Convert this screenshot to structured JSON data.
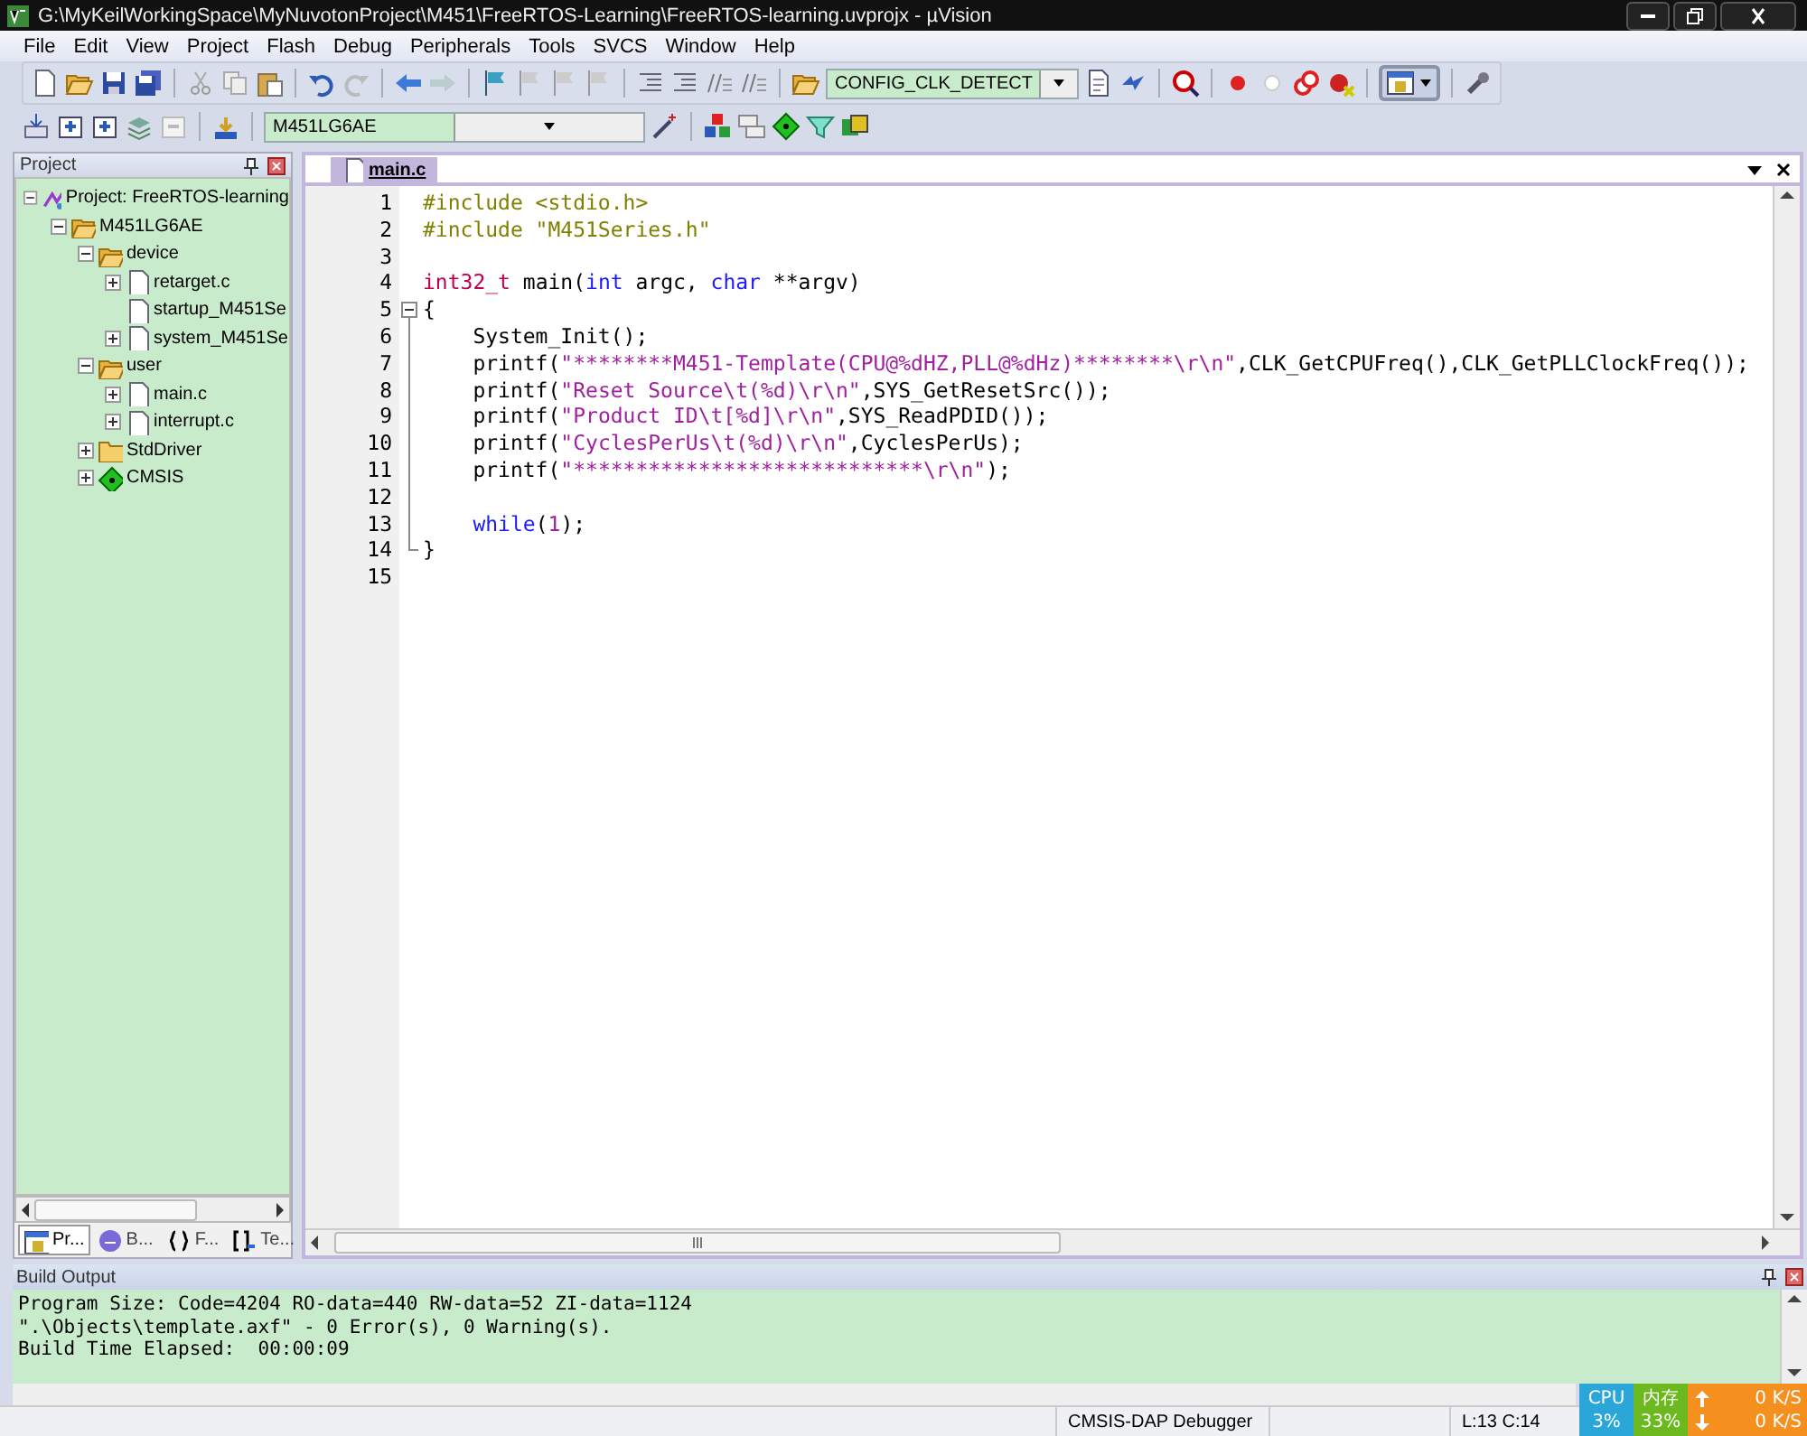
{
  "window": {
    "title": "G:\\MyKeilWorkingSpace\\MyNuvotonProject\\M451\\FreeRTOS-Learning\\FreeRTOS-learning.uvprojx - µVision"
  },
  "menu": [
    "File",
    "Edit",
    "View",
    "Project",
    "Flash",
    "Debug",
    "Peripherals",
    "Tools",
    "SVCS",
    "Window",
    "Help"
  ],
  "toolbar": {
    "config_dropdown": "CONFIG_CLK_DETECT",
    "target_dropdown": "M451LG6AE"
  },
  "project_panel": {
    "title": "Project",
    "tree": [
      {
        "label": "Project: FreeRTOS-learning",
        "kind": "project",
        "expandable": true,
        "expanded": true,
        "children": [
          {
            "label": "M451LG6AE",
            "kind": "target",
            "expandable": true,
            "expanded": true,
            "children": [
              {
                "label": "device",
                "kind": "folder",
                "expandable": true,
                "expanded": true,
                "children": [
                  {
                    "label": "retarget.c",
                    "kind": "file",
                    "expandable": true,
                    "expanded": false
                  },
                  {
                    "label": "startup_M451Se",
                    "kind": "file",
                    "expandable": false
                  },
                  {
                    "label": "system_M451Se",
                    "kind": "file",
                    "expandable": true,
                    "expanded": false
                  }
                ]
              },
              {
                "label": "user",
                "kind": "folder",
                "expandable": true,
                "expanded": true,
                "children": [
                  {
                    "label": "main.c",
                    "kind": "file",
                    "expandable": true,
                    "expanded": false
                  },
                  {
                    "label": "interrupt.c",
                    "kind": "file",
                    "expandable": true,
                    "expanded": false
                  }
                ]
              },
              {
                "label": "StdDriver",
                "kind": "closed-folder",
                "expandable": true,
                "expanded": false
              },
              {
                "label": "CMSIS",
                "kind": "component",
                "expandable": true,
                "expanded": false
              }
            ]
          }
        ]
      }
    ],
    "tabs": [
      {
        "label": "Pr...",
        "kind": "project",
        "selected": true
      },
      {
        "label": "B...",
        "kind": "books",
        "selected": false
      },
      {
        "label": "F...",
        "kind": "functions",
        "selected": false
      },
      {
        "label": "Te...",
        "kind": "templates",
        "selected": false
      }
    ]
  },
  "editor": {
    "tabs": [
      {
        "label": "main.c",
        "selected": true
      }
    ],
    "lines": [
      {
        "number": "1",
        "kind": "plain",
        "tokens": [
          {
            "kind": "preproc",
            "text": "#include <stdio.h>"
          }
        ]
      },
      {
        "number": "2",
        "kind": "plain",
        "tokens": [
          {
            "kind": "preproc",
            "text": "#include \"M451Series.h\""
          }
        ]
      },
      {
        "number": "3",
        "kind": "plain"
      },
      {
        "number": "4",
        "kind": "plain",
        "tokens": [
          {
            "kind": "type",
            "text": "int32_t"
          },
          {
            "kind": "plain",
            "text": " main("
          },
          {
            "kind": "keyword",
            "text": "int"
          },
          {
            "kind": "plain",
            "text": " argc, "
          },
          {
            "kind": "keyword",
            "text": "char"
          },
          {
            "kind": "plain",
            "text": " **argv)"
          }
        ]
      },
      {
        "number": "5",
        "kind": "fold-start",
        "tokens": [
          {
            "kind": "plain",
            "text": "{"
          }
        ]
      },
      {
        "number": "6",
        "kind": "fold-body",
        "tokens": [
          {
            "kind": "plain",
            "text": "    System_Init();"
          }
        ]
      },
      {
        "number": "7",
        "kind": "fold-body",
        "tokens": [
          {
            "kind": "plain",
            "text": "    printf("
          },
          {
            "kind": "string",
            "text": "\"********M451-Template(CPU@%dHZ,PLL@%dHz)********\\r\\n\""
          },
          {
            "kind": "plain",
            "text": ",CLK_GetCPUFreq(),CLK_GetPLLClockFreq());"
          }
        ]
      },
      {
        "number": "8",
        "kind": "fold-body",
        "tokens": [
          {
            "kind": "plain",
            "text": "    printf("
          },
          {
            "kind": "string",
            "text": "\"Reset Source\\t(%d)\\r\\n\""
          },
          {
            "kind": "plain",
            "text": ",SYS_GetResetSrc());"
          }
        ]
      },
      {
        "number": "9",
        "kind": "fold-body",
        "tokens": [
          {
            "kind": "plain",
            "text": "    printf("
          },
          {
            "kind": "string",
            "text": "\"Product ID\\t[%d]\\r\\n\""
          },
          {
            "kind": "plain",
            "text": ",SYS_ReadPDID());"
          }
        ]
      },
      {
        "number": "10",
        "kind": "fold-body",
        "tokens": [
          {
            "kind": "plain",
            "text": "    printf("
          },
          {
            "kind": "string",
            "text": "\"CyclesPerUs\\t(%d)\\r\\n\""
          },
          {
            "kind": "plain",
            "text": ",CyclesPerUs);"
          }
        ]
      },
      {
        "number": "11",
        "kind": "fold-body",
        "tokens": [
          {
            "kind": "plain",
            "text": "    printf("
          },
          {
            "kind": "string",
            "text": "\"****************************\\r\\n\""
          },
          {
            "kind": "plain",
            "text": ");"
          }
        ]
      },
      {
        "number": "12",
        "kind": "fold-body"
      },
      {
        "number": "13",
        "kind": "fold-body",
        "tokens": [
          {
            "kind": "keyword",
            "text": "    while"
          },
          {
            "kind": "plain",
            "text": "("
          },
          {
            "kind": "number",
            "text": "1"
          },
          {
            "kind": "plain",
            "text": ");"
          }
        ]
      },
      {
        "number": "14",
        "kind": "fold-end",
        "tokens": [
          {
            "kind": "plain",
            "text": "}"
          }
        ]
      },
      {
        "number": "15",
        "kind": "plain"
      }
    ]
  },
  "build_output": {
    "title": "Build Output",
    "lines": [
      "Program Size: Code=4204 RO-data=440 RW-data=52 ZI-data=1124",
      "\".\\Objects\\template.axf\" - 0 Error(s), 0 Warning(s).",
      "Build Time Elapsed:  00:00:09"
    ]
  },
  "status_bar": {
    "debugger": "CMSIS-DAP Debugger",
    "position": "L:13 C:14"
  },
  "system_monitor": {
    "cpu_label": "CPU",
    "cpu_value": "3%",
    "memory_label": "内存",
    "memory_value": "33%",
    "upload": "0 K/S",
    "download": "0 K/S"
  }
}
